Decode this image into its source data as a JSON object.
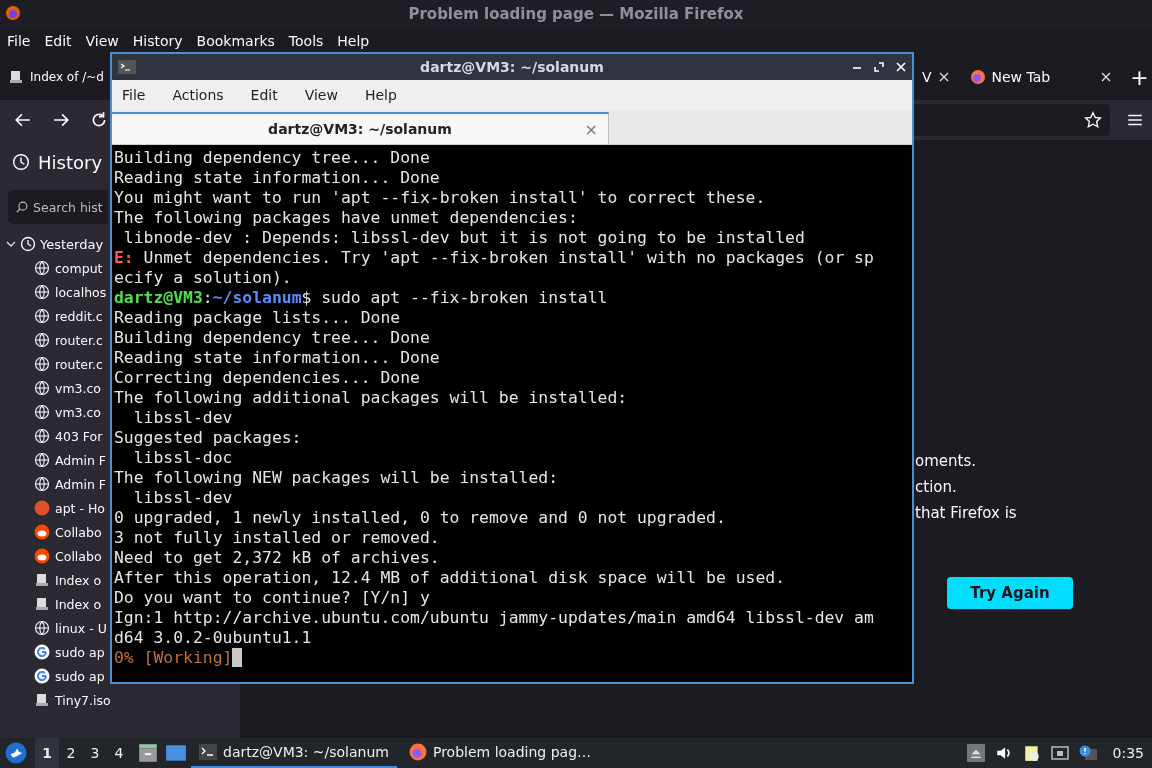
{
  "firefox": {
    "title": "Problem loading page — Mozilla Firefox",
    "menu": [
      "File",
      "Edit",
      "View",
      "History",
      "Bookmarks",
      "Tools",
      "Help"
    ],
    "tabs": [
      {
        "label": "Index of /~d",
        "kind": "server",
        "selected": false,
        "closable": false
      },
      {
        "label": "V",
        "kind": "none",
        "selected": false,
        "closable": true
      },
      {
        "label": "New Tab",
        "kind": "firefox",
        "selected": false,
        "closable": true
      }
    ],
    "new_tab": "+",
    "sidebar": {
      "title": "History",
      "search": {
        "placeholder": "Search hist"
      },
      "tree": [
        {
          "label": "Yesterday",
          "expanded": true,
          "children": [
            {
              "label": "comput",
              "kind": "globe"
            },
            {
              "label": "localhos",
              "kind": "globe"
            },
            {
              "label": "reddit.c",
              "kind": "globe"
            },
            {
              "label": "router.c",
              "kind": "globe"
            },
            {
              "label": "router.c",
              "kind": "globe"
            },
            {
              "label": "vm3.co",
              "kind": "globe"
            },
            {
              "label": "vm3.co",
              "kind": "globe"
            },
            {
              "label": "403 For",
              "kind": "globe"
            },
            {
              "label": "Admin F",
              "kind": "globe"
            },
            {
              "label": "Admin F",
              "kind": "globe"
            },
            {
              "label": "apt - Ho",
              "kind": "ask"
            },
            {
              "label": "Collabo",
              "kind": "reddit"
            },
            {
              "label": "Collabo",
              "kind": "reddit"
            },
            {
              "label": "Index o",
              "kind": "server"
            },
            {
              "label": "Index o",
              "kind": "server"
            },
            {
              "label": "linux - U",
              "kind": "globe"
            },
            {
              "label": "sudo ap",
              "kind": "google"
            },
            {
              "label": "sudo ap",
              "kind": "google"
            },
            {
              "label": "Tiny7.iso",
              "kind": "server"
            }
          ]
        }
      ]
    },
    "error_page": {
      "lines": [
        "oments.",
        "ction.",
        "that Firefox is"
      ],
      "button": "Try Again"
    }
  },
  "terminal": {
    "title": "dartz@VM3: ~/solanum",
    "menu": [
      "File",
      "Actions",
      "Edit",
      "View",
      "Help"
    ],
    "tab": {
      "label": "dartz@VM3: ~/solanum",
      "close": "×"
    },
    "lines": [
      [
        {
          "kind": "text",
          "text": "Building dependency tree... Done"
        }
      ],
      [
        {
          "kind": "text",
          "text": "Reading state information... Done"
        }
      ],
      [
        {
          "kind": "text",
          "text": "You might want to run 'apt --fix-broken install' to correct these."
        }
      ],
      [
        {
          "kind": "text",
          "text": "The following packages have unmet dependencies:"
        }
      ],
      [
        {
          "kind": "text",
          "text": " libnode-dev : Depends: libssl-dev but it is not going to be installed"
        }
      ],
      [
        {
          "kind": "error",
          "text": "E:"
        },
        {
          "kind": "text",
          "text": " Unmet dependencies. Try 'apt --fix-broken install' with no packages (or sp"
        }
      ],
      [
        {
          "kind": "text",
          "text": "ecify a solution)."
        }
      ],
      [
        {
          "kind": "user",
          "text": "dartz@VM3"
        },
        {
          "kind": "text",
          "text": ":"
        },
        {
          "kind": "path",
          "text": "~/solanum"
        },
        {
          "kind": "text",
          "text": "$ sudo apt --fix-broken install"
        }
      ],
      [
        {
          "kind": "text",
          "text": "Reading package lists... Done"
        }
      ],
      [
        {
          "kind": "text",
          "text": "Building dependency tree... Done"
        }
      ],
      [
        {
          "kind": "text",
          "text": "Reading state information... Done"
        }
      ],
      [
        {
          "kind": "text",
          "text": "Correcting dependencies... Done"
        }
      ],
      [
        {
          "kind": "text",
          "text": "The following additional packages will be installed:"
        }
      ],
      [
        {
          "kind": "text",
          "text": "  libssl-dev"
        }
      ],
      [
        {
          "kind": "text",
          "text": "Suggested packages:"
        }
      ],
      [
        {
          "kind": "text",
          "text": "  libssl-doc"
        }
      ],
      [
        {
          "kind": "text",
          "text": "The following NEW packages will be installed:"
        }
      ],
      [
        {
          "kind": "text",
          "text": "  libssl-dev"
        }
      ],
      [
        {
          "kind": "text",
          "text": "0 upgraded, 1 newly installed, 0 to remove and 0 not upgraded."
        }
      ],
      [
        {
          "kind": "text",
          "text": "3 not fully installed or removed."
        }
      ],
      [
        {
          "kind": "text",
          "text": "Need to get 2,372 kB of archives."
        }
      ],
      [
        {
          "kind": "text",
          "text": "After this operation, 12.4 MB of additional disk space will be used."
        }
      ],
      [
        {
          "kind": "text",
          "text": "Do you want to continue? [Y/n] y"
        }
      ],
      [
        {
          "kind": "text",
          "text": "Ign:1 http://archive.ubuntu.com/ubuntu jammy-updates/main amd64 libssl-dev am"
        }
      ],
      [
        {
          "kind": "text",
          "text": "d64 3.0.2-0ubuntu1.1"
        }
      ],
      [
        {
          "kind": "progress",
          "text": "0% [Working]"
        }
      ]
    ],
    "cursor": true
  },
  "taskbar": {
    "workspaces": [
      {
        "label": "1",
        "selected": true
      },
      {
        "label": "2",
        "selected": false
      },
      {
        "label": "3",
        "selected": false
      },
      {
        "label": "4",
        "selected": false
      }
    ],
    "tasks": [
      {
        "label": "dartz@VM3: ~/solanum",
        "kind": "terminal",
        "selected": true
      },
      {
        "label": "Problem loading pag…",
        "kind": "firefox",
        "selected": false
      }
    ],
    "clock": "0:35"
  }
}
